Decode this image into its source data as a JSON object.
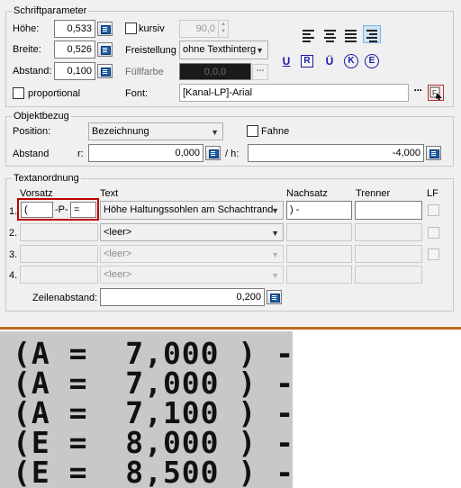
{
  "schrift": {
    "title": "Schriftparameter",
    "hoehe_label": "Höhe:",
    "hoehe_value": "0,533",
    "breite_label": "Breite:",
    "breite_value": "0,526",
    "abstand_label": "Abstand:",
    "abstand_value": "0,100",
    "proportional_label": "proportional",
    "kursiv_label": "kursiv",
    "kursiv_angle": "90,0",
    "freistellung_label": "Freistellung",
    "freistellung_value": "ohne Texthinterg",
    "fuellfarbe_label": "Füllfarbe",
    "fuellfarbe_value": "0,0,0",
    "font_label": "Font:",
    "font_value": "[Kanal-LP]-Arial",
    "align_icons": [
      "align-left-icon",
      "align-center-icon",
      "align-justify-icon",
      "align-right-icon"
    ],
    "format_buttons": [
      "U",
      "R",
      "Ü",
      "K",
      "E"
    ]
  },
  "objektbezug": {
    "title": "Objektbezug",
    "position_label": "Position:",
    "position_value": "Bezeichnung",
    "fahne_label": "Fahne",
    "abstand_label": "Abstand",
    "r_label": "r:",
    "r_value": "0,000",
    "h_label": "/  h:",
    "h_value": "-4,000"
  },
  "textanordnung": {
    "title": "Textanordnung",
    "col_vorsatz": "Vorsatz",
    "col_text": "Text",
    "col_nachsatz": "Nachsatz",
    "col_trenner": "Trenner",
    "col_lf": "LF",
    "rows": [
      {
        "num": "1.",
        "vorsatz_a": "(",
        "vorsatz_sep": "-P-",
        "vorsatz_b": "=",
        "text": "Höhe Haltungssohlen am Schachtrand",
        "nachsatz": ") -",
        "trenner": ""
      },
      {
        "num": "2.",
        "text": "<leer>"
      },
      {
        "num": "3.",
        "text": "<leer>"
      },
      {
        "num": "4.",
        "text": "<leer>"
      }
    ],
    "zeilenabstand_label": "Zeilenabstand:",
    "zeilenabstand_value": "0,200"
  },
  "preview": {
    "lines": [
      "(A =  7,000 ) -",
      "(A =  7,000 ) -",
      "(A =  7,100 ) -",
      "(E =  8,000 ) -",
      "(E =  8,500 ) -"
    ]
  },
  "colors": {
    "dialog_bg": "#f0f0f0",
    "separator": "#b86a22",
    "preview_bg": "#c8c8c8",
    "highlight_box": "#c00000",
    "format_blue": "#1a1aa8"
  }
}
